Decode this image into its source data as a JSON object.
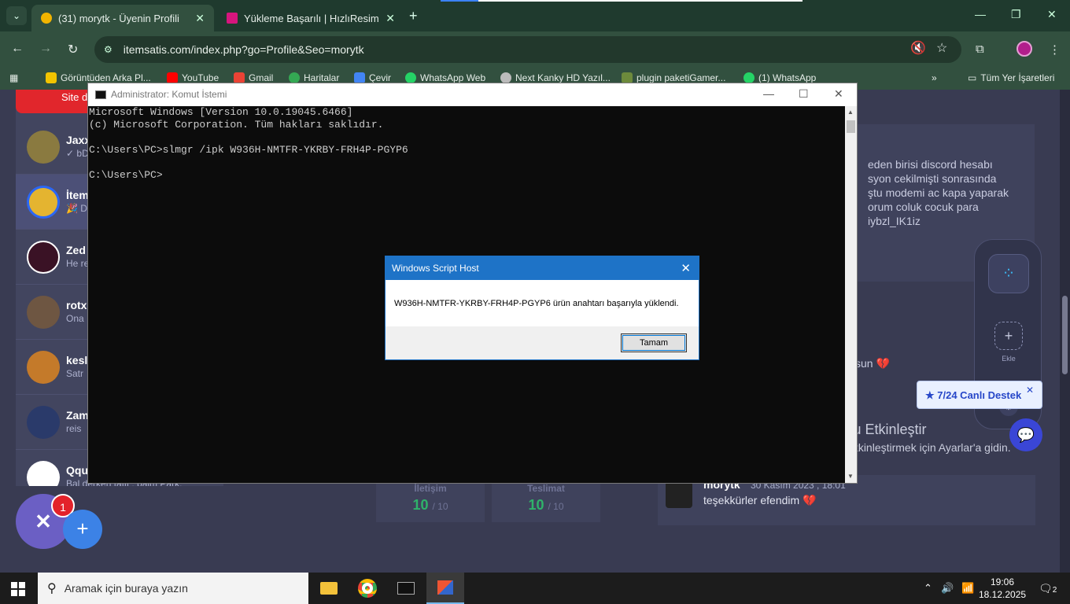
{
  "browser": {
    "tabs": [
      {
        "title": "(31) morytk - Üyenin Profili",
        "active": true
      },
      {
        "title": "Yükleme Başarılı | HızlıResim",
        "active": false
      }
    ],
    "url": "itemsatis.com/index.php?go=Profile&Seo=morytk",
    "bookmarks": [
      "Görüntüden Arka Pl...",
      "YouTube",
      "Gmail",
      "Haritalar",
      "Çevir",
      "WhatsApp Web",
      "Next Kanky HD Yazıl...",
      "plugin paketiGamer...",
      "(1) WhatsApp"
    ],
    "all_bookmarks": "Tüm Yer İşaretleri",
    "colors": {
      "accent": "#1e73c7",
      "frame": "#32503f"
    }
  },
  "webpage": {
    "red_button": "Site d",
    "chats": [
      {
        "name": "Jaxx",
        "snippet": "✓ bD"
      },
      {
        "name": "İtem",
        "snippet": "🎉 D"
      },
      {
        "name": "Zed",
        "snippet": "He re"
      },
      {
        "name": "rotx",
        "snippet": "Ona"
      },
      {
        "name": "kesl",
        "snippet": "Satr"
      },
      {
        "name": "Zam",
        "snippet": "reis"
      },
      {
        "name": "Qqu",
        "snippet": "Bal derken tatlı , balm Park."
      }
    ],
    "right_text": [
      "eden birisi discord hesabı",
      "syon cekilmişti sonrasında",
      "ştu modemi ac kapa yaparak",
      "orum coluk cocuk para",
      "iybzl_IK1iz"
    ],
    "right_text2": "sun 💔",
    "ratings": [
      {
        "label": "İletişim",
        "value": "10",
        "max": "/ 10"
      },
      {
        "label": "Teslimat",
        "value": "10",
        "max": "/ 10"
      }
    ],
    "comment": {
      "user": "morytk",
      "date": "30 Kasım 2023 , 18:01",
      "text": "teşekkürler efendim 💔"
    },
    "dock": {
      "add_label": "Ekle"
    },
    "support": "★ 7/24 Canlı Destek",
    "fab_badge": "1",
    "activate_title": "Windows'u Etkinleştir",
    "activate_sub": "Windows'u etkinleştirmek için Ayarlar'a gidin."
  },
  "cmd": {
    "title": "Administrator: Komut İstemi",
    "output": "Microsoft Windows [Version 10.0.19045.6466]\n(c) Microsoft Corporation. Tüm hakları saklıdır.\n\nC:\\Users\\PC>slmgr /ipk W936H-NMTFR-YKRBY-FRH4P-PGYP6\n\nC:\\Users\\PC>"
  },
  "dialog": {
    "title": "Windows Script Host",
    "message": "W936H-NMTFR-YKRBY-FRH4P-PGYP6 ürün anahtarı başarıyla yüklendi.",
    "ok": "Tamam"
  },
  "taskbar": {
    "search_placeholder": "Aramak için buraya yazın",
    "time": "19:06",
    "date": "18.12.2025",
    "notif_count": "2"
  }
}
